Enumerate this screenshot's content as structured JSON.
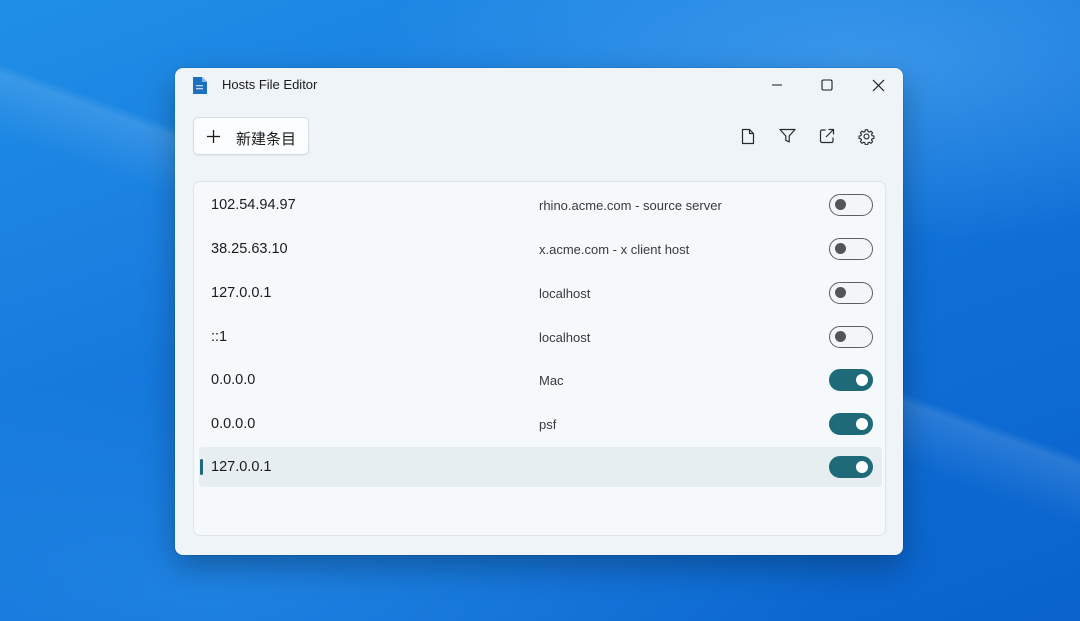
{
  "window": {
    "title": "Hosts File Editor",
    "icon": "document-file-icon"
  },
  "title_controls": [
    "minimize-icon",
    "maximize-icon",
    "close-icon"
  ],
  "toolbar": {
    "new_entry_label": "新建条目",
    "icons": [
      "open-hosts-file-icon",
      "filter-icon",
      "open-external-icon",
      "settings-gear-icon"
    ]
  },
  "entries": [
    {
      "ip": "102.54.94.97",
      "host": "rhino.acme.com - source server",
      "enabled": false
    },
    {
      "ip": "38.25.63.10",
      "host": "x.acme.com - x client host",
      "enabled": false
    },
    {
      "ip": "127.0.0.1",
      "host": "localhost",
      "enabled": false
    },
    {
      "ip": "::1",
      "host": "localhost",
      "enabled": false
    },
    {
      "ip": "0.0.0.0",
      "host": "Mac",
      "enabled": true
    },
    {
      "ip": "0.0.0.0",
      "host": "psf",
      "enabled": true
    },
    {
      "ip": "127.0.0.1",
      "host": "",
      "enabled": true,
      "selected": true
    }
  ],
  "colors": {
    "accent": "#1e6a78",
    "window_bg": "#eef4f7",
    "desktop": "#1a7fe0"
  }
}
